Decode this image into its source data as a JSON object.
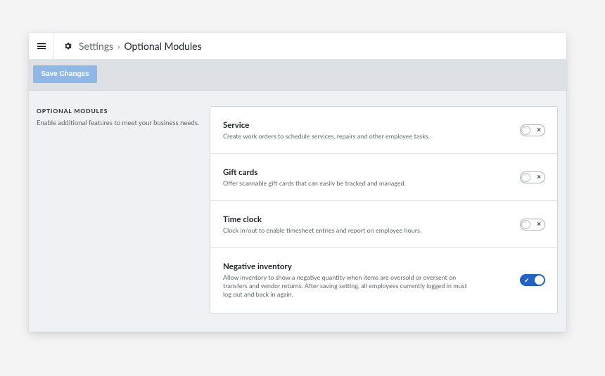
{
  "breadcrumb": {
    "parent": "Settings",
    "separator": "›",
    "current": "Optional Modules"
  },
  "toolbar": {
    "save_label": "Save Changes"
  },
  "section": {
    "title": "OPTIONAL MODULES",
    "description": "Enable additional features to meet your business needs."
  },
  "modules": [
    {
      "title": "Service",
      "description": "Create work orders to schedule services, repairs and other employee tasks.",
      "enabled": false
    },
    {
      "title": "Gift cards",
      "description": "Offer scannable gift cards that can easily be tracked and managed.",
      "enabled": false
    },
    {
      "title": "Time clock",
      "description": "Clock in/out to enable timesheet entries and report on employee hours.",
      "enabled": false
    },
    {
      "title": "Negative inventory",
      "description": "Allow inventory to show a negative quantity when items are oversold or oversent on transfers and vendor returns. After saving setting, all employees currently logged in must log out and back in again.",
      "enabled": true
    }
  ],
  "icons": {
    "menu": "hamburger-icon",
    "settings": "gear-icon",
    "toggle_off": "x-icon",
    "toggle_on": "check-icon"
  },
  "colors": {
    "accent": "#1f63c5",
    "save_button": "#8fb8e6",
    "action_bar": "#dde1e5"
  }
}
